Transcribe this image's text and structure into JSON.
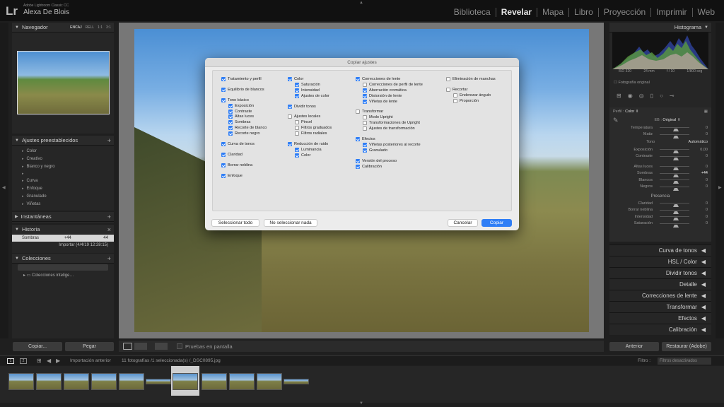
{
  "app": {
    "logo": "Lr",
    "name": "Adobe Lightroom Classic CC",
    "user": "Alexa De Blois"
  },
  "modules": [
    "Biblioteca",
    "Revelar",
    "Mapa",
    "Libro",
    "Proyección",
    "Imprimir",
    "Web"
  ],
  "active_module": "Revelar",
  "left": {
    "navigator": {
      "title": "Navegador",
      "tabs": [
        "ENCAJ",
        "RELL",
        "1:1",
        "3:1"
      ]
    },
    "presets": {
      "title": "Ajustes preestablecidos",
      "items": [
        "Color",
        "Creativo",
        "Blanco y negro",
        "Curva",
        "Enfoque",
        "Granulado",
        "Viñetas"
      ]
    },
    "snapshots": {
      "title": "Instantáneas"
    },
    "history": {
      "title": "Historia",
      "rows": [
        {
          "label": "Sombras",
          "a": "+44",
          "b": "44"
        },
        {
          "label": "Importar (4/4/19 12:28:15)",
          "a": "",
          "b": ""
        }
      ]
    },
    "collections": {
      "title": "Colecciones",
      "item": "Colecciones intelige…"
    },
    "copy_label": "Copiar...",
    "paste_label": "Pegar"
  },
  "toolbar": {
    "soft_proof": "Pruebas en pantalla"
  },
  "right": {
    "histogram": {
      "title": "Histograma",
      "iso": "ISO 320",
      "focal": "24 mm",
      "aperture": "f / 10",
      "shutter": "1/800 seg",
      "original": "Fotografía original"
    },
    "basic": {
      "profile_label": "Perfil :",
      "profile_value": "Color",
      "wb_label": "EB :",
      "wb_value": "Original",
      "temp": {
        "label": "Temperatura",
        "value": "0"
      },
      "tint": {
        "label": "Matiz",
        "value": "0"
      },
      "tone_label": "Tono",
      "tone_auto": "Automático",
      "exposure": {
        "label": "Exposición",
        "value": "0,00"
      },
      "contrast": {
        "label": "Contraste",
        "value": "0"
      },
      "highlights": {
        "label": "Altas luces",
        "value": "0"
      },
      "shadows": {
        "label": "Sombras",
        "value": "+44"
      },
      "whites": {
        "label": "Blancos",
        "value": "0"
      },
      "blacks": {
        "label": "Negros",
        "value": "0"
      },
      "presence_label": "Presencia",
      "clarity": {
        "label": "Claridad",
        "value": "0"
      },
      "dehaze": {
        "label": "Borrar neblina",
        "value": "0"
      },
      "vibrance": {
        "label": "Intensidad",
        "value": "0"
      },
      "saturation": {
        "label": "Saturación",
        "value": "0"
      }
    },
    "collapsed": [
      "Curva de tonos",
      "HSL / Color",
      "Dividir tonos",
      "Detalle",
      "Correcciones de lente",
      "Transformar",
      "Efectos",
      "Calibración"
    ],
    "prev_label": "Anterior",
    "reset_label": "Restaurar (Adobe)"
  },
  "filmstrip": {
    "pages": [
      "1",
      "2"
    ],
    "source": "Importación anterior",
    "info": "11 fotografías /1 seleccionada(s) /_DSC0895.jpg",
    "filter_label": "Filtro :",
    "filter_value": "Filtros desactivados"
  },
  "dialog": {
    "title": "Copiar ajustes",
    "col1": [
      {
        "label": "Tratamiento y perfil",
        "on": true,
        "sub": false
      },
      {
        "gap": true
      },
      {
        "label": "Equilibrio de blancos",
        "on": true,
        "sub": false
      },
      {
        "gap": true
      },
      {
        "label": "Tono básico",
        "on": true,
        "sub": false
      },
      {
        "label": "Exposición",
        "on": true,
        "sub": true
      },
      {
        "label": "Contraste",
        "on": true,
        "sub": true
      },
      {
        "label": "Altas luces",
        "on": true,
        "sub": true
      },
      {
        "label": "Sombras",
        "on": true,
        "sub": true
      },
      {
        "label": "Recorte de blanco",
        "on": true,
        "sub": true
      },
      {
        "label": "Recorte negro",
        "on": true,
        "sub": true
      },
      {
        "gap": true
      },
      {
        "label": "Curva de tonos",
        "on": true,
        "sub": false
      },
      {
        "gap": true
      },
      {
        "label": "Claridad",
        "on": true,
        "sub": false
      },
      {
        "gap": true
      },
      {
        "label": "Borrar neblina",
        "on": true,
        "sub": false
      },
      {
        "gap": true
      },
      {
        "label": "Enfoque",
        "on": true,
        "sub": false
      }
    ],
    "col2": [
      {
        "label": "Color",
        "on": true,
        "sub": false
      },
      {
        "label": "Saturación",
        "on": true,
        "sub": true
      },
      {
        "label": "Intensidad",
        "on": true,
        "sub": true
      },
      {
        "label": "Ajustes de color",
        "on": true,
        "sub": true
      },
      {
        "gap": true
      },
      {
        "label": "Dividir tonos",
        "on": true,
        "sub": false
      },
      {
        "gap": true
      },
      {
        "label": "Ajustes locales",
        "on": false,
        "sub": false
      },
      {
        "label": "Pincel",
        "on": false,
        "sub": true
      },
      {
        "label": "Filtros graduados",
        "on": false,
        "sub": true
      },
      {
        "label": "Filtros radiales",
        "on": false,
        "sub": true
      },
      {
        "gap": true
      },
      {
        "label": "Reducción de ruido",
        "on": true,
        "sub": false
      },
      {
        "label": "Luminancia",
        "on": true,
        "sub": true
      },
      {
        "label": "Color",
        "on": true,
        "sub": true
      }
    ],
    "col3": [
      {
        "label": "Correcciones de lente",
        "on": true,
        "sub": false
      },
      {
        "label": "Correcciones de perfil de lente",
        "on": false,
        "sub": true
      },
      {
        "label": "Aberración cromática",
        "on": true,
        "sub": true
      },
      {
        "label": "Distorsión de lente",
        "on": true,
        "sub": true
      },
      {
        "label": "Viñetas de lente",
        "on": true,
        "sub": true
      },
      {
        "gap": true
      },
      {
        "label": "Transformar",
        "on": false,
        "sub": false
      },
      {
        "label": "Modo Upright",
        "on": false,
        "sub": true
      },
      {
        "label": "Transformaciones de Upright",
        "on": false,
        "sub": true
      },
      {
        "label": "Ajustes de transformación",
        "on": false,
        "sub": true
      },
      {
        "gap": true
      },
      {
        "label": "Efectos",
        "on": true,
        "sub": false
      },
      {
        "label": "Viñetas posteriores al recorte",
        "on": true,
        "sub": true
      },
      {
        "label": "Granulado",
        "on": true,
        "sub": true
      },
      {
        "gap": true
      },
      {
        "label": "Versión del proceso",
        "on": true,
        "sub": false
      },
      {
        "label": "Calibración",
        "on": true,
        "sub": false
      }
    ],
    "col4": [
      {
        "label": "Eliminación de manchas",
        "on": false,
        "sub": false
      },
      {
        "gap": true
      },
      {
        "label": "Recortar",
        "on": false,
        "sub": false
      },
      {
        "label": "Enderezar ángulo",
        "on": false,
        "sub": true
      },
      {
        "label": "Proporción",
        "on": false,
        "sub": true
      }
    ],
    "select_all": "Seleccionar todo",
    "select_none": "No seleccionar nada",
    "cancel": "Cancelar",
    "copy": "Copiar"
  }
}
